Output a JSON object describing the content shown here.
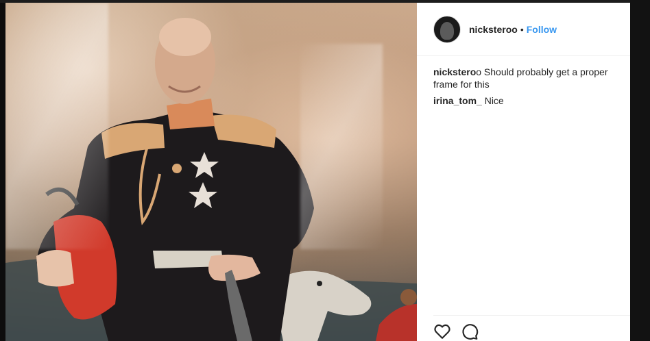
{
  "post": {
    "username": "nicksteroo",
    "separator": "•",
    "follow_label": "Follow"
  },
  "comments": [
    {
      "user": "nickstero",
      "text": "o Should probably get a proper frame for this"
    },
    {
      "user": "irina_tom_",
      "text": " Nice"
    }
  ],
  "icons": {
    "like": "heart-icon",
    "comment": "comment-icon"
  },
  "colors": {
    "accent": "#3897f0",
    "text": "#262626"
  }
}
